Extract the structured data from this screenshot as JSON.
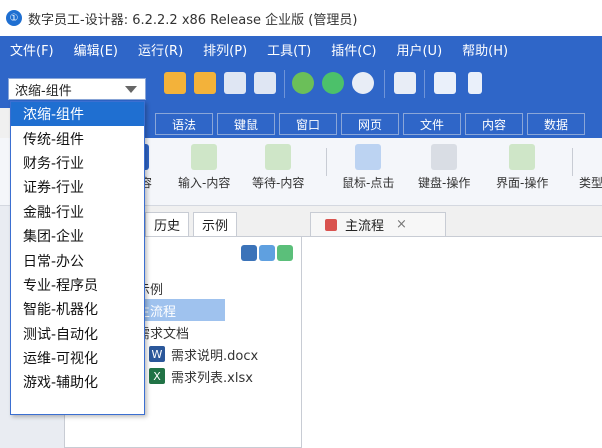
{
  "title_bar": {
    "app_icon_glyph": "①",
    "title": "数字员工-设计器: 6.2.2.2 x86 Release 企业版 (管理员)"
  },
  "menu": [
    {
      "label": "文件(F)"
    },
    {
      "label": "编辑(E)"
    },
    {
      "label": "运行(R)"
    },
    {
      "label": "排列(P)"
    },
    {
      "label": "工具(T)"
    },
    {
      "label": "插件(C)"
    },
    {
      "label": "用户(U)"
    },
    {
      "label": "帮助(H)"
    }
  ],
  "category_select": {
    "value": "浓缩-组件"
  },
  "category_options": [
    "浓缩-组件",
    "传统-组件",
    "财务-行业",
    "证券-行业",
    "金融-行业",
    "集团-企业",
    "日常-办公",
    "专业-程序员",
    "智能-机器化",
    "测试-自动化",
    "运维-可视化",
    "游戏-辅助化"
  ],
  "component_tabs": [
    {
      "label": "语法"
    },
    {
      "label": "键鼠"
    },
    {
      "label": "窗口"
    },
    {
      "label": "网页"
    },
    {
      "label": "文件"
    },
    {
      "label": "内容"
    },
    {
      "label": "数据"
    }
  ],
  "palette": [
    {
      "label": "内容"
    },
    {
      "label": "输入-内容"
    },
    {
      "label": "等待-内容"
    },
    {
      "label": "鼠标-点击"
    },
    {
      "label": "键盘-操作"
    },
    {
      "label": "界面-操作"
    },
    {
      "label": "类型"
    }
  ],
  "left_tabs": [
    {
      "label": "历史"
    },
    {
      "label": "示例"
    }
  ],
  "tree": [
    {
      "label": "示例",
      "icon": ""
    },
    {
      "label": "主流程",
      "icon": ""
    },
    {
      "label": "需求文档",
      "icon": ""
    },
    {
      "label": "需求说明.docx",
      "icon": "W"
    },
    {
      "label": "需求列表.xlsx",
      "icon": "X"
    }
  ],
  "editor_tab": {
    "label": "主流程",
    "close_glyph": "×"
  },
  "colors": {
    "accent": "#2f66c8",
    "selected": "#1f6fd1",
    "tree_selected": "#9fc2ee",
    "word": "#2b579a",
    "excel": "#217346"
  }
}
